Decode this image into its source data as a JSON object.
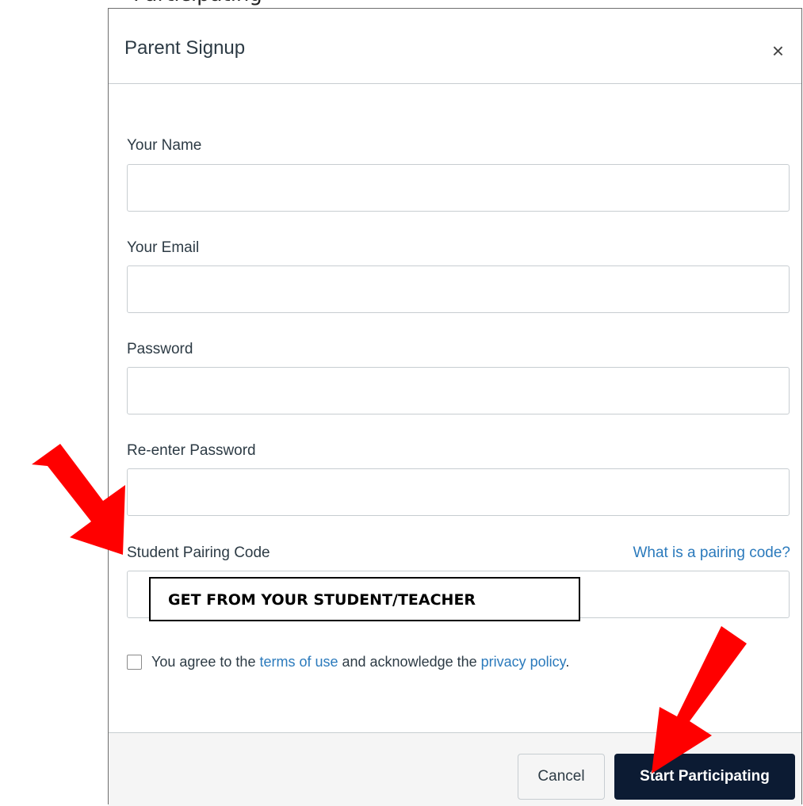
{
  "page_header": {
    "cut_text": "Participating"
  },
  "modal": {
    "title": "Parent Signup",
    "close_symbol": "×"
  },
  "fields": {
    "name": {
      "label": "Your Name",
      "value": "",
      "placeholder": ""
    },
    "email": {
      "label": "Your Email",
      "value": "",
      "placeholder": ""
    },
    "password": {
      "label": "Password",
      "value": "",
      "placeholder": ""
    },
    "password_confirm": {
      "label": "Re-enter Password",
      "value": "",
      "placeholder": ""
    },
    "pairing_code": {
      "label": "Student Pairing Code",
      "help_link": "What is a pairing code?",
      "value": "",
      "placeholder": ""
    }
  },
  "callout": {
    "text": "GET FROM YOUR STUDENT/TEACHER"
  },
  "agreement": {
    "checked": false,
    "prefix": "You agree to the ",
    "terms_link": "terms of use",
    "middle": " and acknowledge the ",
    "privacy_link": "privacy policy",
    "suffix": "."
  },
  "footer": {
    "cancel_label": "Cancel",
    "submit_label": "Start Participating"
  },
  "colors": {
    "primary_button": "#0c1b33",
    "link": "#2b7abc",
    "annotation_arrow": "#ff0000",
    "footer_bg": "#f5f5f5"
  },
  "icons": [
    "close-icon",
    "checkbox-icon",
    "annotation-arrow-icon"
  ]
}
